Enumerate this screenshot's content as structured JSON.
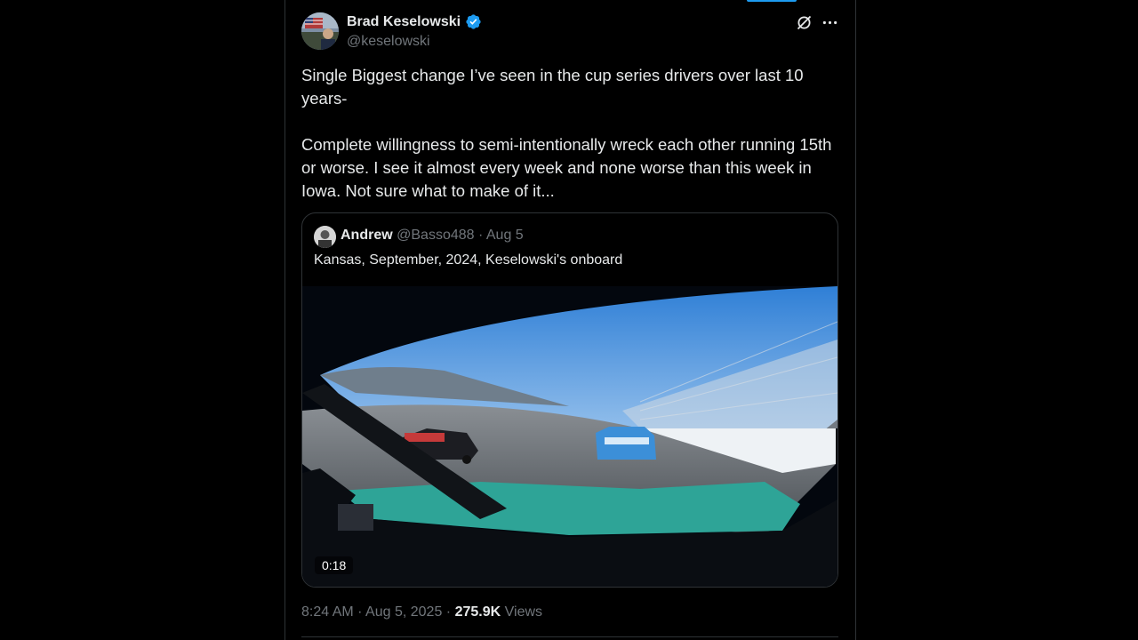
{
  "tweet": {
    "author_name": "Brad Keselowski",
    "author_handle": "@keselowski",
    "verified": true,
    "text_paragraph_1": "Single Biggest change I’ve seen in the cup series drivers over last 10 years-",
    "text_paragraph_2": "Complete willingness to semi-intentionally wreck each other running 15th or worse. I see it almost every week and none worse than this week in Iowa. Not sure what to make of it...",
    "time": "8:24 AM",
    "date": "Aug 5, 2025",
    "views_count": "275.9K",
    "views_label": "Views",
    "separator": "·"
  },
  "quote": {
    "author_name": "Andrew",
    "author_handle": "@Basso488",
    "date": "Aug 5",
    "text": "Kansas, September, 2024, Keselowski's onboard",
    "video_duration": "0:18"
  },
  "icons": {
    "verified": "verified-badge-icon",
    "grok": "grok-icon",
    "more": "more-icon"
  },
  "colors": {
    "background": "#000000",
    "accent": "#1d9bf0",
    "text_primary": "#e7e9ea",
    "text_secondary": "#71767b",
    "border": "#2f3336"
  }
}
